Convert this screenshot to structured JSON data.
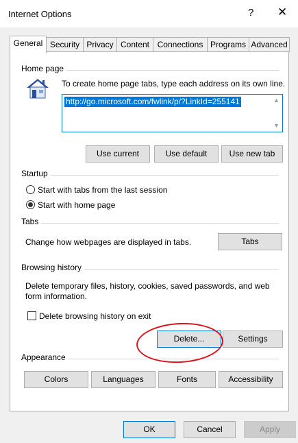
{
  "window": {
    "title": "Internet Options",
    "help": "?",
    "close": "✕"
  },
  "tabs": [
    "General",
    "Security",
    "Privacy",
    "Content",
    "Connections",
    "Programs",
    "Advanced"
  ],
  "home_page": {
    "group_title": "Home page",
    "description": "To create home page tabs, type each address on its own line.",
    "url": "http://go.microsoft.com/fwlink/p/?LinkId=255141",
    "buttons": {
      "use_current": "Use current",
      "use_default": "Use default",
      "use_new_tab": "Use new tab"
    }
  },
  "startup": {
    "group_title": "Startup",
    "options": [
      "Start with tabs from the last session",
      "Start with home page"
    ],
    "selected_index": 1
  },
  "tabs_group": {
    "group_title": "Tabs",
    "description": "Change how webpages are displayed in tabs.",
    "button": "Tabs"
  },
  "browsing_history": {
    "group_title": "Browsing history",
    "description_line1": "Delete temporary files, history, cookies, saved passwords, and web",
    "description_line2": "form information.",
    "delete_on_exit_label": "Delete browsing history on exit",
    "delete_on_exit_checked": false,
    "delete_button": "Delete...",
    "settings_button": "Settings"
  },
  "appearance": {
    "group_title": "Appearance",
    "buttons": [
      "Colors",
      "Languages",
      "Fonts",
      "Accessibility"
    ]
  },
  "footer": {
    "ok": "OK",
    "cancel": "Cancel",
    "apply": "Apply"
  },
  "annotation": {
    "color": "#e0131b"
  }
}
